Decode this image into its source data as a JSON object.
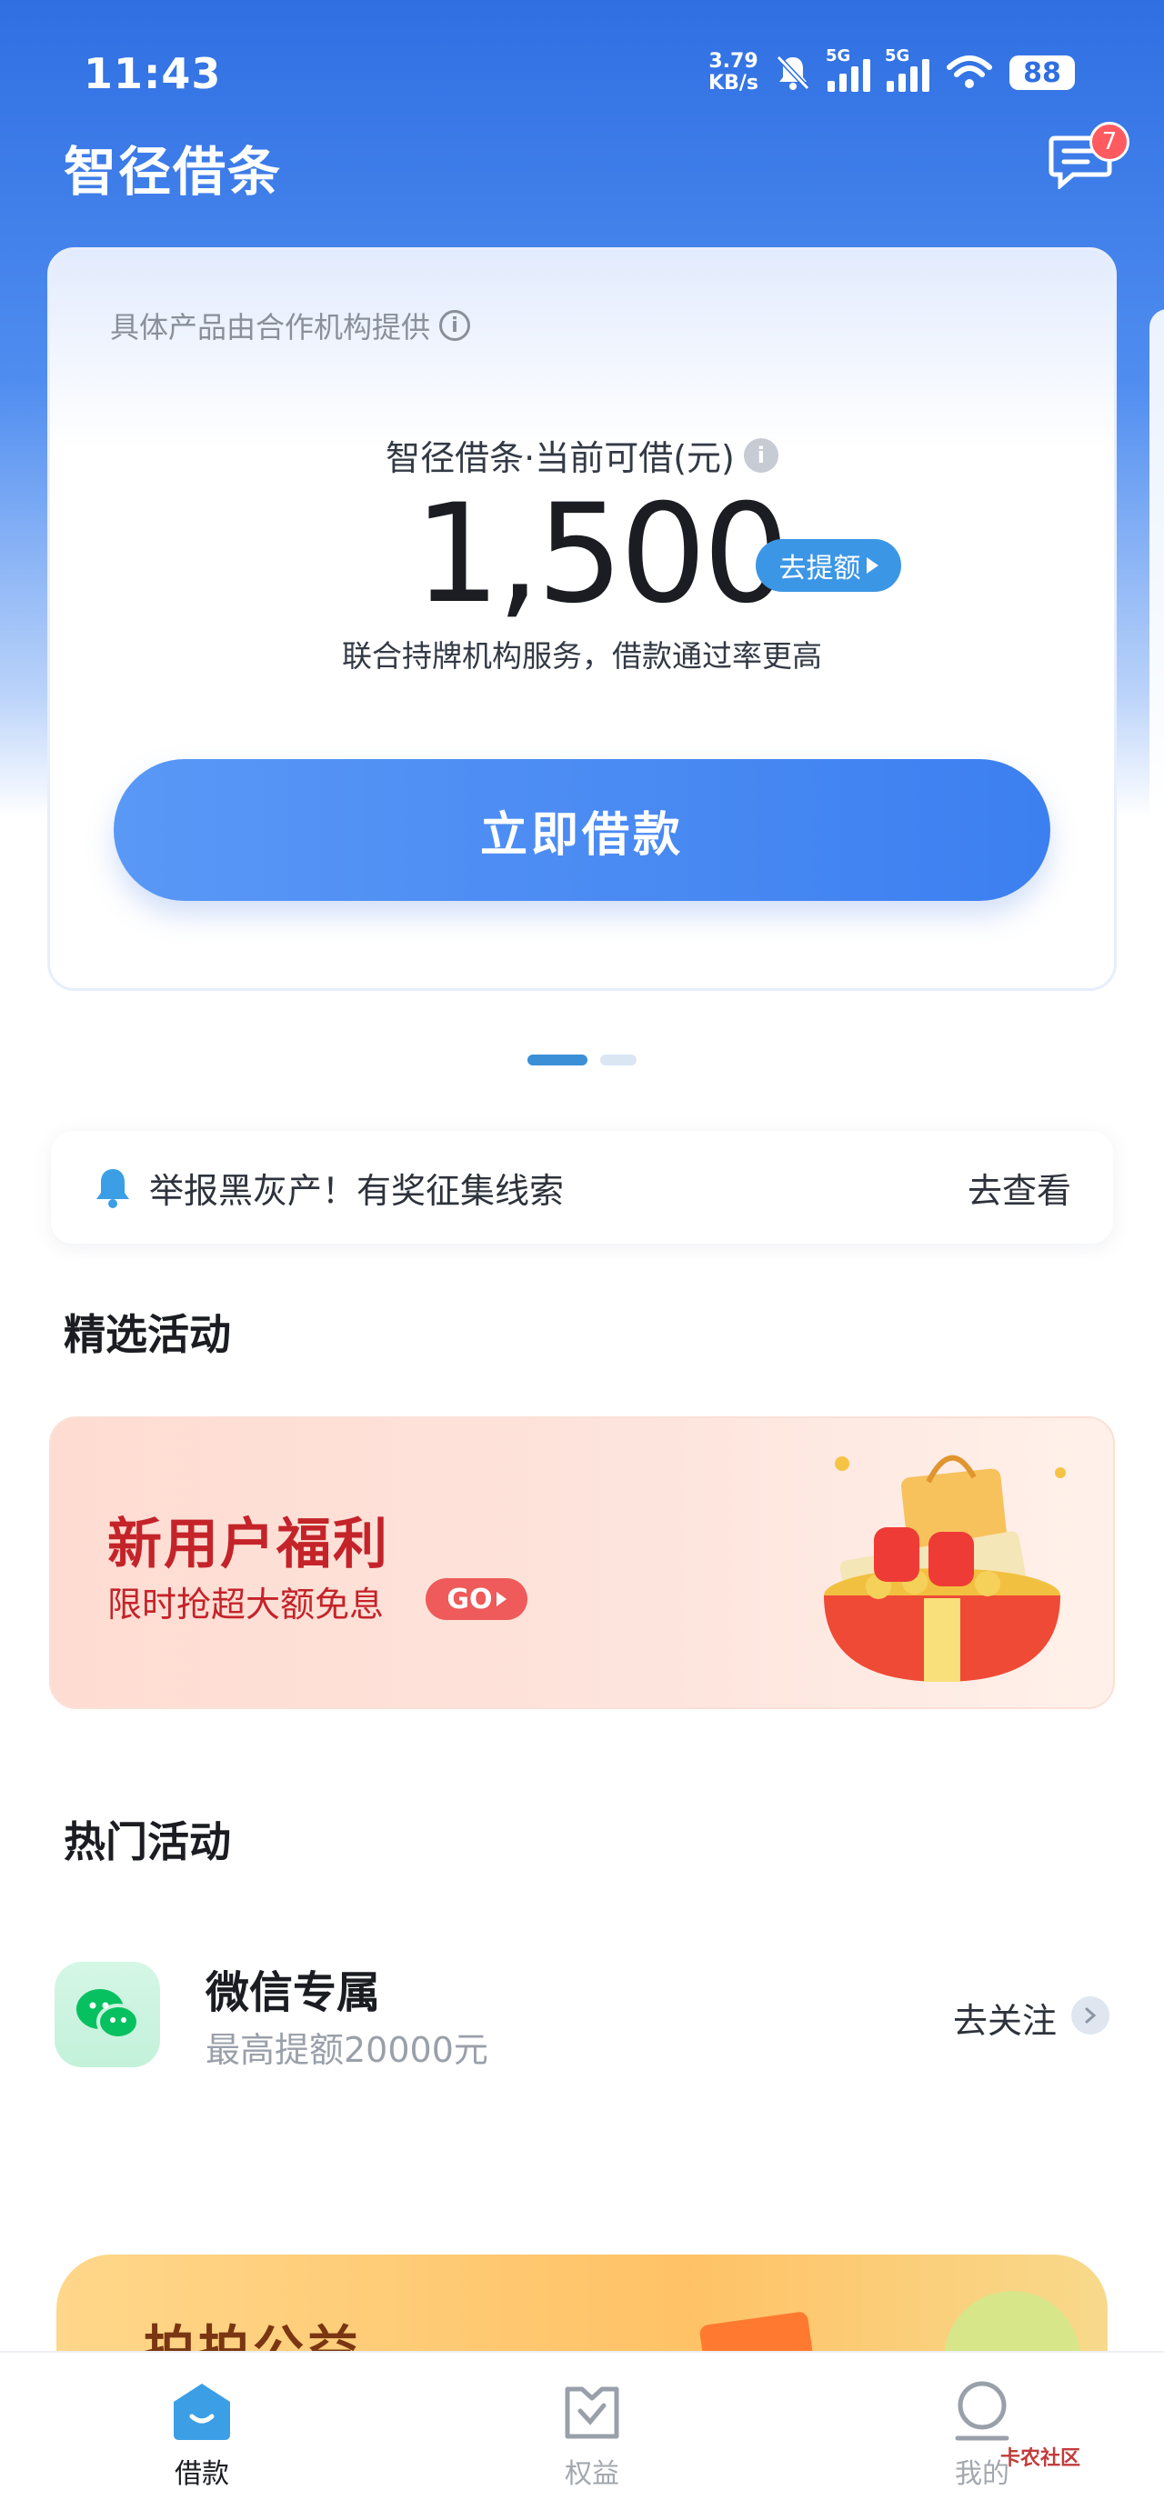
{
  "status_bar": {
    "time": "11:43",
    "net_speed_value": "3.79",
    "net_speed_unit": "KB/s",
    "sim1": "5G",
    "sim2": "5G",
    "battery": "88"
  },
  "header": {
    "title": "智径借条",
    "message_badge": "7"
  },
  "loan_card": {
    "provider_note": "具体产品由合作机构提供",
    "limit_label": "智径借条·当前可借(元)",
    "amount": "1,500",
    "raise_limit_label": "去提额",
    "promo": "联合持牌机构服务，借款通过率更高",
    "borrow_button": "立即借款"
  },
  "notice": {
    "text": "举报黑灰产！有奖征集线索",
    "link": "去查看"
  },
  "featured": {
    "section_title": "精选活动",
    "banner_title": "新用户福利",
    "banner_subtitle": "限时抢超大额免息",
    "go_label": "GO"
  },
  "hot": {
    "section_title": "热门活动",
    "items": [
      {
        "title": "微信专属",
        "subtitle": "最高提额20000元",
        "action": "去关注",
        "icon": "wechat-icon"
      }
    ]
  },
  "bottom_banner": {
    "title": "拍拍公益"
  },
  "tabbar": {
    "tabs": [
      {
        "label": "借款",
        "active": true,
        "icon": "home-icon"
      },
      {
        "label": "权益",
        "active": false,
        "icon": "benefit-icon"
      },
      {
        "label": "我的",
        "active": false,
        "icon": "profile-icon"
      }
    ]
  },
  "watermark": "卡农社区",
  "colors": {
    "primary": "#3c7ff0",
    "header_gradient_top": "#2f6fe2",
    "badge_red": "#ff5a5f",
    "banner_red": "#c4232a",
    "wechat_green": "#07c160"
  }
}
